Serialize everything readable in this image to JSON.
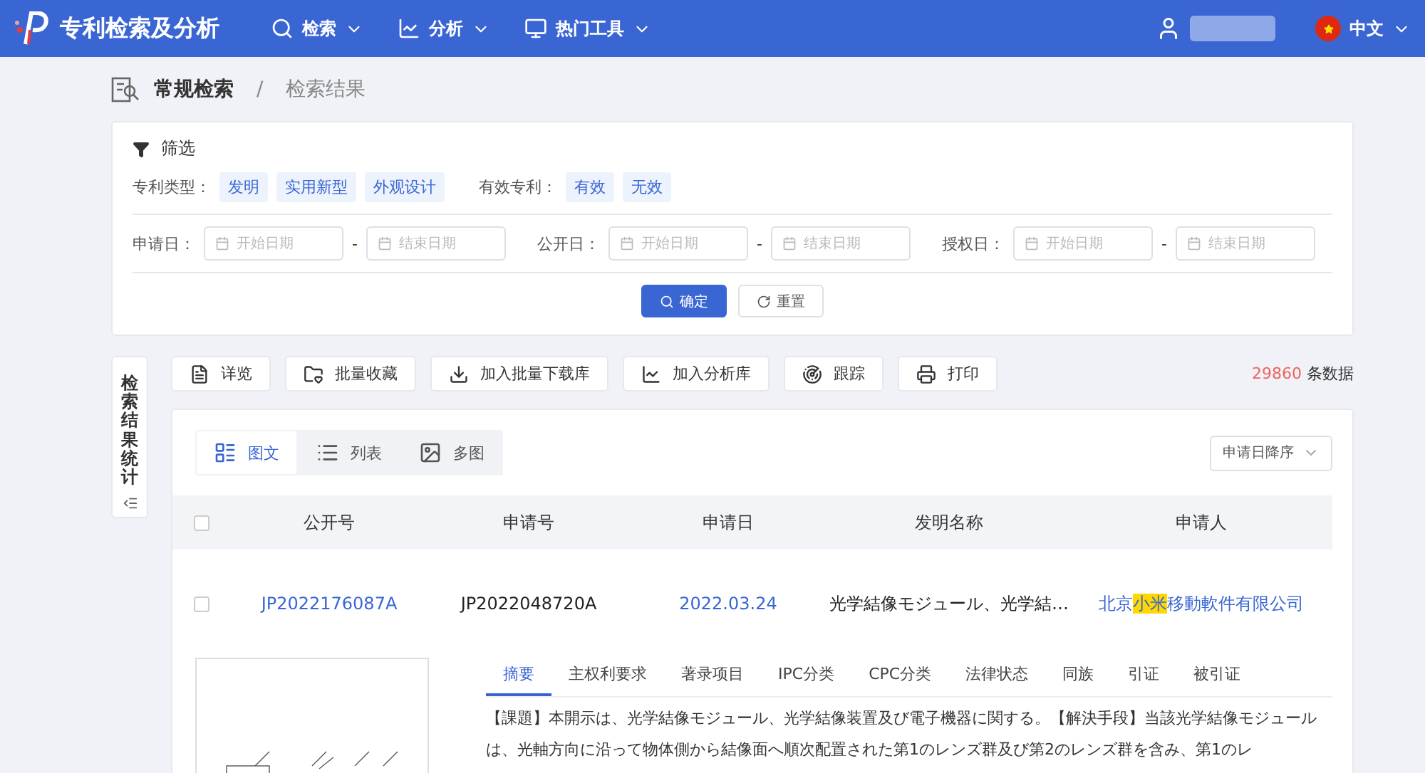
{
  "header": {
    "app_title": "专利检索及分析",
    "nav": [
      {
        "label": "检索"
      },
      {
        "label": "分析"
      },
      {
        "label": "热门工具"
      }
    ],
    "language": "中文"
  },
  "breadcrumb": {
    "items": [
      "常规检索",
      "检索结果"
    ],
    "separator": "/"
  },
  "filter": {
    "title": "筛选",
    "tag_groups": [
      {
        "label": "专利类型：",
        "tags": [
          "发明",
          "实用新型",
          "外观设计"
        ]
      },
      {
        "label": "有效专利：",
        "tags": [
          "有效",
          "无效"
        ]
      }
    ],
    "date_groups": [
      {
        "label": "申请日：",
        "start_placeholder": "开始日期",
        "separator": "-",
        "end_placeholder": "结束日期"
      },
      {
        "label": "公开日：",
        "start_placeholder": "开始日期",
        "separator": "-",
        "end_placeholder": "结束日期"
      },
      {
        "label": "授权日：",
        "start_placeholder": "开始日期",
        "separator": "-",
        "end_placeholder": "结束日期"
      }
    ],
    "confirm": "确定",
    "reset": "重置"
  },
  "side_tab": {
    "label": "检索结果统计"
  },
  "toolbar": [
    "详览",
    "批量收藏",
    "加入批量下载库",
    "加入分析库",
    "跟踪",
    "打印"
  ],
  "result_count": {
    "number": "29860",
    "unit": "条数据"
  },
  "view_tabs": [
    {
      "label": "图文",
      "selected": true
    },
    {
      "label": "列表",
      "selected": false
    },
    {
      "label": "多图",
      "selected": false
    }
  ],
  "sort": {
    "value": "申请日降序"
  },
  "table": {
    "select_all_checked": false,
    "columns": [
      "公开号",
      "申请号",
      "申请日",
      "发明名称",
      "申请人"
    ],
    "rows": [
      {
        "checked": false,
        "publication_no": "JP2022176087A",
        "application_no": "JP2022048720A",
        "application_date": "2022.03.24",
        "title": "光学結像モジュール、光学結…",
        "applicant": [
          {
            "text": "北京",
            "highlight": false
          },
          {
            "text": "小米",
            "highlight": true
          },
          {
            "text": "移動軟件有限公司",
            "highlight": false
          }
        ],
        "detail_tabs": [
          {
            "label": "摘要",
            "selected": true
          },
          {
            "label": "主权利要求",
            "selected": false
          },
          {
            "label": "著录项目",
            "selected": false
          },
          {
            "label": "IPC分类",
            "selected": false
          },
          {
            "label": "CPC分类",
            "selected": false
          },
          {
            "label": "法律状态",
            "selected": false
          },
          {
            "label": "同族",
            "selected": false
          },
          {
            "label": "引证",
            "selected": false
          },
          {
            "label": "被引证",
            "selected": false
          }
        ],
        "abstract": "【課題】本開示は、光学結像モジュール、光学結像装置及び電子機器に関する。【解決手段】当該光学結像モジュールは、光軸方向に沿って物体側から結像面へ順次配置された第1のレンズ群及び第2のレンズ群を含み、第1のレ"
      }
    ]
  }
}
